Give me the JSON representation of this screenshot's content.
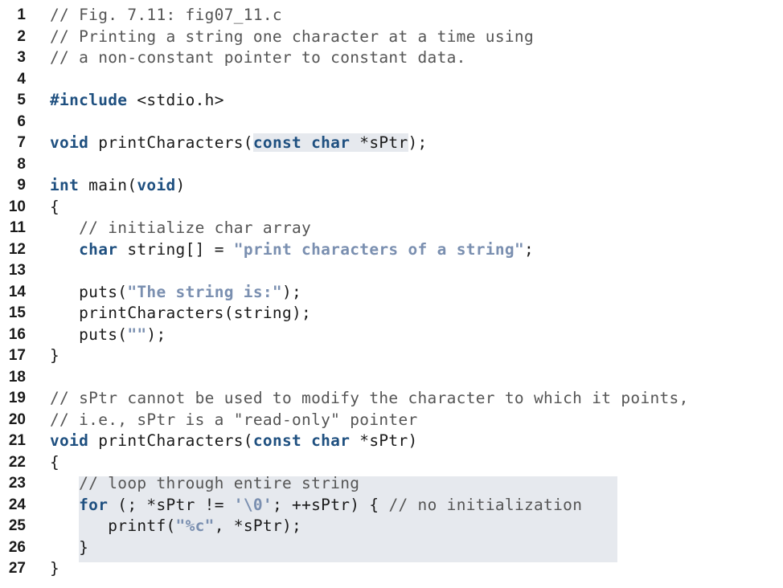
{
  "listing": {
    "lines": [
      {
        "n": "1",
        "segs": [
          {
            "t": "// Fig. 7.11: fig07_11.c",
            "c": "cm"
          }
        ]
      },
      {
        "n": "2",
        "segs": [
          {
            "t": "// Printing a string one character at a time using",
            "c": "cm"
          }
        ]
      },
      {
        "n": "3",
        "segs": [
          {
            "t": "// a non-constant pointer to constant data.",
            "c": "cm"
          }
        ]
      },
      {
        "n": "4",
        "segs": []
      },
      {
        "n": "5",
        "segs": [
          {
            "t": "#include",
            "c": "kw"
          },
          {
            "t": " <stdio.h>",
            "c": ""
          }
        ]
      },
      {
        "n": "6",
        "segs": []
      },
      {
        "n": "7",
        "segs": [
          {
            "t": "void",
            "c": "kw"
          },
          {
            "t": " printCharacters(",
            "c": ""
          },
          {
            "t": "const char",
            "c": "kw hl"
          },
          {
            "t": " *sPtr",
            "c": "hl"
          },
          {
            "t": ");",
            "c": ""
          }
        ]
      },
      {
        "n": "8",
        "segs": []
      },
      {
        "n": "9",
        "segs": [
          {
            "t": "int",
            "c": "kw"
          },
          {
            "t": " main(",
            "c": ""
          },
          {
            "t": "void",
            "c": "kw"
          },
          {
            "t": ")",
            "c": ""
          }
        ]
      },
      {
        "n": "10",
        "segs": [
          {
            "t": "{",
            "c": ""
          }
        ]
      },
      {
        "n": "11",
        "segs": [
          {
            "t": "   // initialize char array",
            "c": "cm"
          }
        ]
      },
      {
        "n": "12",
        "segs": [
          {
            "t": "   ",
            "c": ""
          },
          {
            "t": "char",
            "c": "kw"
          },
          {
            "t": " string[] = ",
            "c": ""
          },
          {
            "t": "\"print characters of a string\"",
            "c": "str"
          },
          {
            "t": ";",
            "c": ""
          }
        ]
      },
      {
        "n": "13",
        "segs": []
      },
      {
        "n": "14",
        "segs": [
          {
            "t": "   puts(",
            "c": ""
          },
          {
            "t": "\"The string is:\"",
            "c": "str"
          },
          {
            "t": ");",
            "c": ""
          }
        ]
      },
      {
        "n": "15",
        "segs": [
          {
            "t": "   printCharacters(string);",
            "c": ""
          }
        ]
      },
      {
        "n": "16",
        "segs": [
          {
            "t": "   puts(",
            "c": ""
          },
          {
            "t": "\"\"",
            "c": "str"
          },
          {
            "t": ");",
            "c": ""
          }
        ]
      },
      {
        "n": "17",
        "segs": [
          {
            "t": "}",
            "c": ""
          }
        ]
      },
      {
        "n": "18",
        "segs": []
      },
      {
        "n": "19",
        "segs": [
          {
            "t": "// sPtr cannot be used to modify the character to which it points,",
            "c": "cm"
          }
        ]
      },
      {
        "n": "20",
        "segs": [
          {
            "t": "// i.e., sPtr is a \"read-only\" pointer",
            "c": "cm"
          }
        ]
      },
      {
        "n": "21",
        "segs": [
          {
            "t": "void",
            "c": "kw"
          },
          {
            "t": " printCharacters(",
            "c": ""
          },
          {
            "t": "const char",
            "c": "kw"
          },
          {
            "t": " *sPtr)",
            "c": ""
          }
        ]
      },
      {
        "n": "22",
        "segs": [
          {
            "t": "{",
            "c": ""
          }
        ]
      },
      {
        "n": "23",
        "segs": [
          {
            "t": "   ",
            "c": ""
          },
          {
            "t": "// loop through entire string",
            "c": "cm"
          }
        ]
      },
      {
        "n": "24",
        "segs": [
          {
            "t": "   ",
            "c": ""
          },
          {
            "t": "for",
            "c": "kw"
          },
          {
            "t": " (; *sPtr != ",
            "c": ""
          },
          {
            "t": "'\\0'",
            "c": "str"
          },
          {
            "t": "; ++sPtr) { ",
            "c": ""
          },
          {
            "t": "// no initialization",
            "c": "cm"
          }
        ]
      },
      {
        "n": "25",
        "segs": [
          {
            "t": "      printf(",
            "c": ""
          },
          {
            "t": "\"%c\"",
            "c": "str"
          },
          {
            "t": ", *sPtr);",
            "c": ""
          }
        ]
      },
      {
        "n": "26",
        "segs": [
          {
            "t": "   }",
            "c": ""
          }
        ]
      },
      {
        "n": "27",
        "segs": [
          {
            "t": "}",
            "c": ""
          }
        ]
      }
    ]
  }
}
